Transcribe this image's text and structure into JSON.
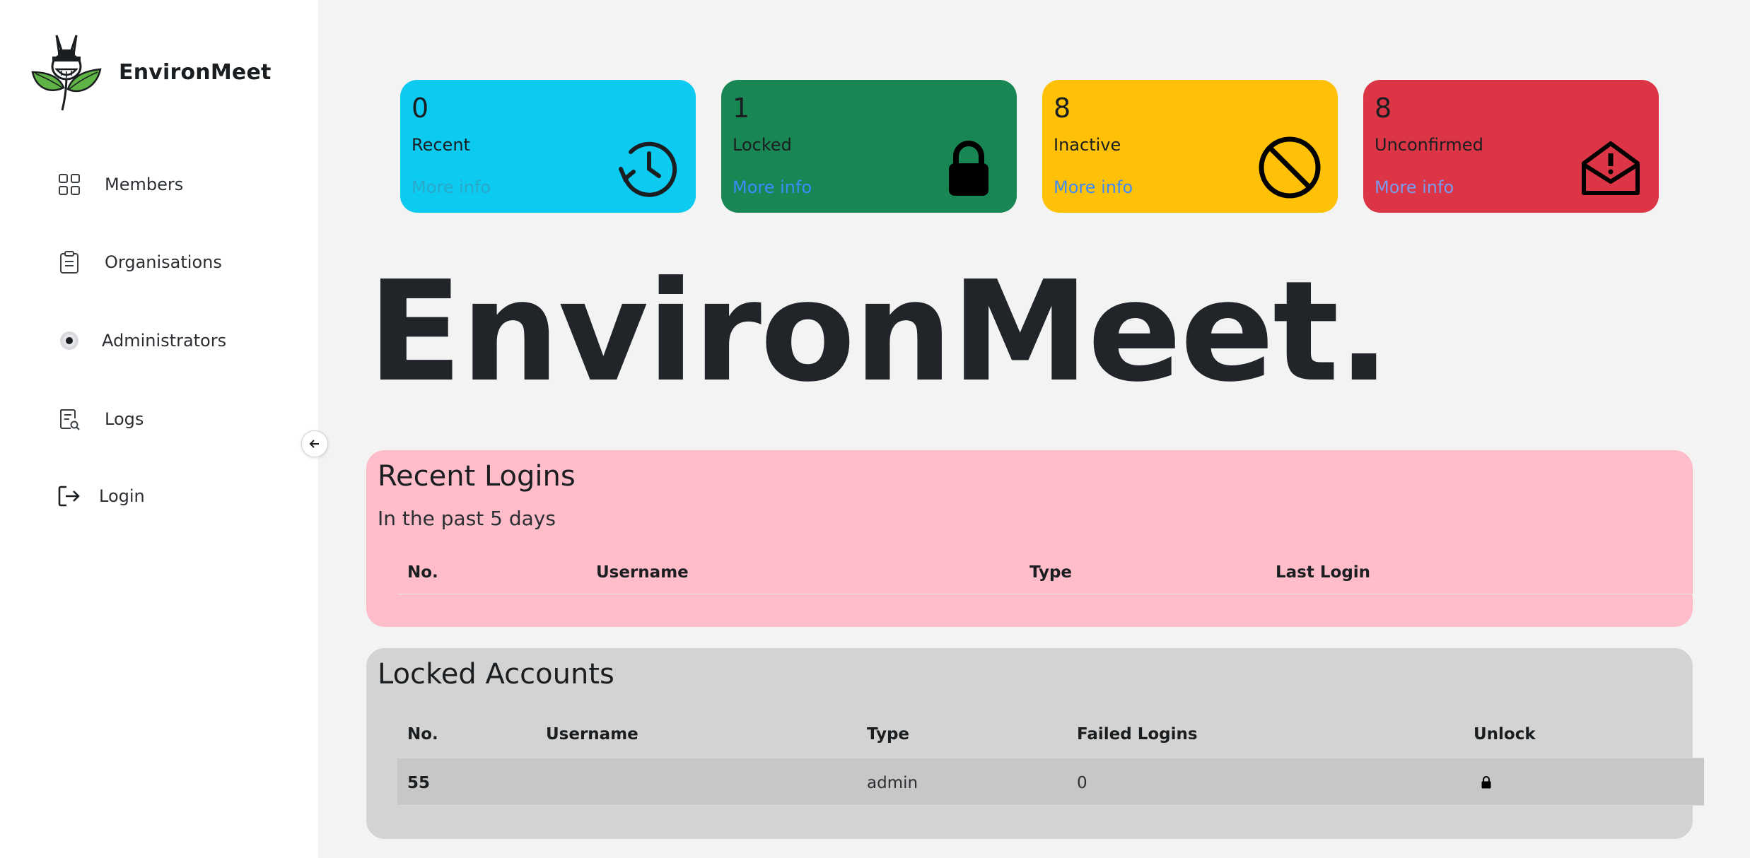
{
  "sidebar": {
    "brand": "EnvironMeet",
    "items": [
      {
        "label": "Members",
        "icon": "grid-icon"
      },
      {
        "label": "Organisations",
        "icon": "clipboard-icon"
      },
      {
        "label": "Administrators",
        "icon": "gear-icon"
      },
      {
        "label": "Logs",
        "icon": "log-search-icon"
      },
      {
        "label": "Login",
        "icon": "login-icon"
      }
    ]
  },
  "cards": [
    {
      "count": "0",
      "label": "Recent",
      "link": "More info",
      "icon": "history-icon",
      "color": "#0dcaf0"
    },
    {
      "count": "1",
      "label": "Locked",
      "link": "More info",
      "icon": "lock-icon",
      "color": "#198754"
    },
    {
      "count": "8",
      "label": "Inactive",
      "link": "More info",
      "icon": "ban-icon",
      "color": "#ffc107"
    },
    {
      "count": "8",
      "label": "Unconfirmed",
      "link": "More info",
      "icon": "envelope-alert-icon",
      "color": "#dc3545"
    }
  ],
  "hero": "EnvironMeet.",
  "recent_logins": {
    "title": "Recent Logins",
    "subtitle": "In the past 5 days",
    "columns": [
      "No.",
      "Username",
      "Type",
      "Last Login"
    ],
    "rows": []
  },
  "locked_accounts": {
    "title": "Locked Accounts",
    "columns": [
      "No.",
      "Username",
      "Type",
      "Failed Logins",
      "Unlock"
    ],
    "rows": [
      {
        "no": "55",
        "username": "",
        "type": "admin",
        "failed": "0"
      }
    ]
  }
}
